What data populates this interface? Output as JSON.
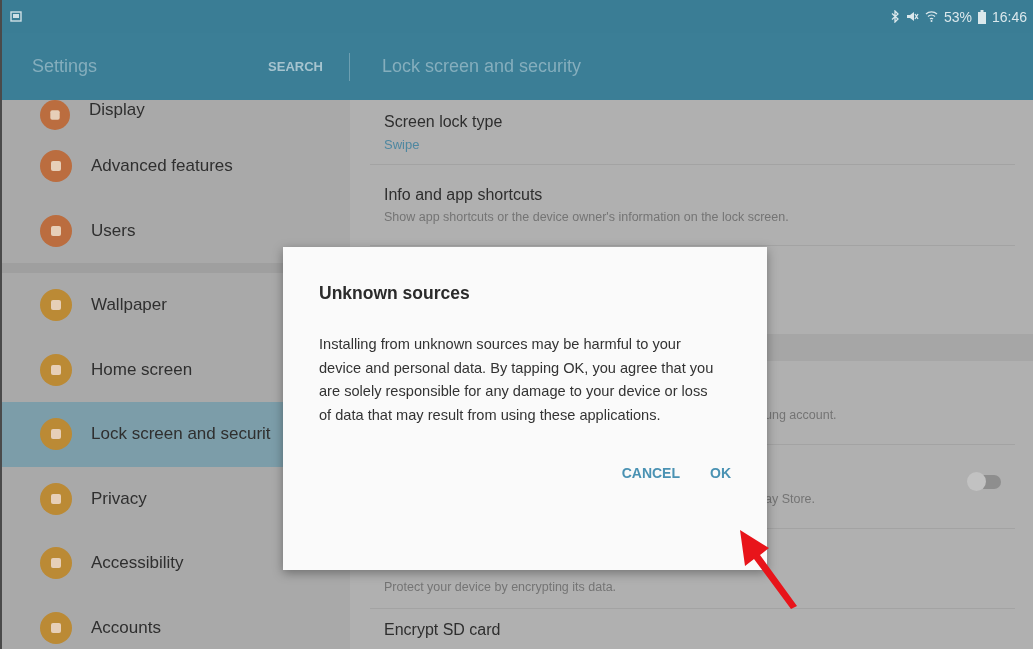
{
  "status_bar": {
    "battery_text": "53%",
    "time": "16:46"
  },
  "app_bar": {
    "title": "Settings",
    "search": "SEARCH",
    "page_title": "Lock screen and security"
  },
  "sidebar": {
    "groups": [
      {
        "items": [
          {
            "label": "Display",
            "selected": false
          },
          {
            "label": "Advanced features",
            "selected": false
          },
          {
            "label": "Users",
            "selected": false
          }
        ]
      },
      {
        "items": [
          {
            "label": "Wallpaper",
            "selected": false
          },
          {
            "label": "Home screen",
            "selected": false
          },
          {
            "label": "Lock screen and securit",
            "selected": true
          },
          {
            "label": "Privacy",
            "selected": false
          },
          {
            "label": "Accessibility",
            "selected": false
          },
          {
            "label": "Accounts",
            "selected": false
          }
        ]
      }
    ]
  },
  "content": {
    "rows": [
      {
        "kind": "setting",
        "title": "Screen lock type",
        "value": "Swipe"
      },
      {
        "kind": "setting",
        "title": "Info and app shortcuts",
        "subtitle": "Show app shortcuts or the device owner's information on the lock screen."
      },
      {
        "kind": "covered"
      },
      {
        "kind": "header"
      },
      {
        "kind": "fragment",
        "subtitle": "ung account."
      },
      {
        "kind": "fragment",
        "subtitle": "ay Store.",
        "toggle": {
          "on": false
        }
      },
      {
        "kind": "setting",
        "subtitle": "Protect your device by encrypting its data."
      },
      {
        "kind": "setting",
        "title": "Encrypt SD card"
      }
    ]
  },
  "dialog": {
    "title": "Unknown sources",
    "message": "Installing from unknown sources may be harmful to your device and personal data. By tapping OK, you agree that you are solely responsible for any damage to your device or loss of data that may result from using these applications.",
    "buttons": [
      "CANCEL",
      "OK"
    ]
  }
}
